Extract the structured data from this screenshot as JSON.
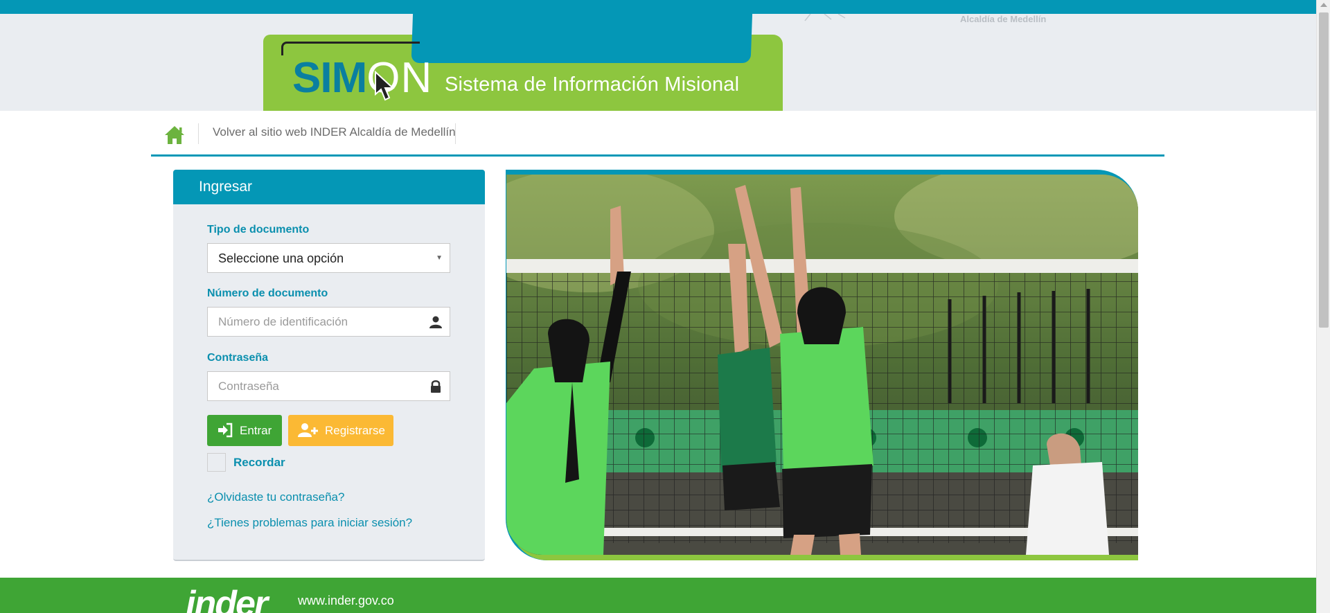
{
  "header": {
    "alcaldia_text": "Alcaldía de Medellín",
    "logo_sim": "SIM",
    "logo_on": "ON",
    "system_title": "Sistema de Información Misional"
  },
  "nav": {
    "home_icon": "home-icon",
    "back_link": "Volver al sitio web INDER Alcaldía de Medellín"
  },
  "login": {
    "title": "Ingresar",
    "doc_type_label": "Tipo de documento",
    "doc_type_selected": "Seleccione una opción",
    "doc_number_label": "Número de documento",
    "doc_number_placeholder": "Número de identificación",
    "password_label": "Contraseña",
    "password_placeholder": "Contraseña",
    "enter_button": "Entrar",
    "register_button": "Registrarse",
    "remember_label": "Recordar",
    "forgot_link": "¿Olvidaste tu contraseña?",
    "trouble_link": "¿Tienes problemas para iniciar sesión?"
  },
  "footer": {
    "logo_text": "inder",
    "url": "www.inder.gov.co"
  },
  "colors": {
    "primary_blue": "#0497b6",
    "lime_green": "#8dc63f",
    "button_green": "#3fa535",
    "button_orange": "#fbb934",
    "header_bg": "#eaedf1"
  }
}
